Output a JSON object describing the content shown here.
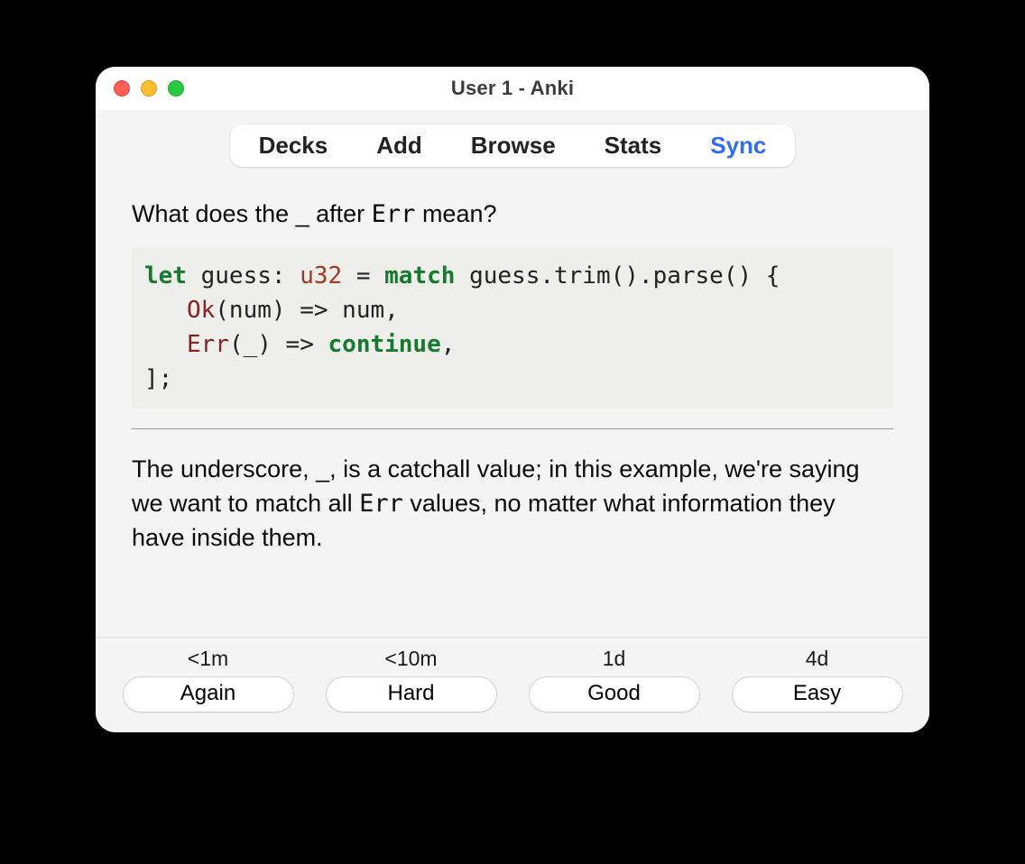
{
  "window": {
    "title": "User 1 - Anki"
  },
  "tabs": [
    {
      "id": "decks",
      "label": "Decks",
      "active": false
    },
    {
      "id": "add",
      "label": "Add",
      "active": false
    },
    {
      "id": "browse",
      "label": "Browse",
      "active": false
    },
    {
      "id": "stats",
      "label": "Stats",
      "active": false
    },
    {
      "id": "sync",
      "label": "Sync",
      "active": true
    }
  ],
  "card": {
    "question_prefix": "What does the _ after ",
    "question_code": "Err",
    "question_suffix": " mean?",
    "code": {
      "kw_let": "let",
      "var_guess1": " guess: ",
      "type_u32": "u32",
      "eq": " = ",
      "kw_match": "match",
      "after_match": " guess.trim().parse() {",
      "indent1": "   ",
      "enum_ok": "Ok",
      "ok_rest": "(num) => num,",
      "indent2": "   ",
      "enum_err": "Err",
      "err_args": "(_) => ",
      "kw_continue": "continue",
      "err_tail": ",",
      "closer": "];"
    },
    "answer_p1": "The underscore, _, is a catchall value; in this example, we're saying we want to match all ",
    "answer_code": "Err",
    "answer_p2": " values, no matter what information they have inside them."
  },
  "ratings": [
    {
      "time": "<1m",
      "label": "Again"
    },
    {
      "time": "<10m",
      "label": "Hard"
    },
    {
      "time": "1d",
      "label": "Good"
    },
    {
      "time": "4d",
      "label": "Easy"
    }
  ]
}
